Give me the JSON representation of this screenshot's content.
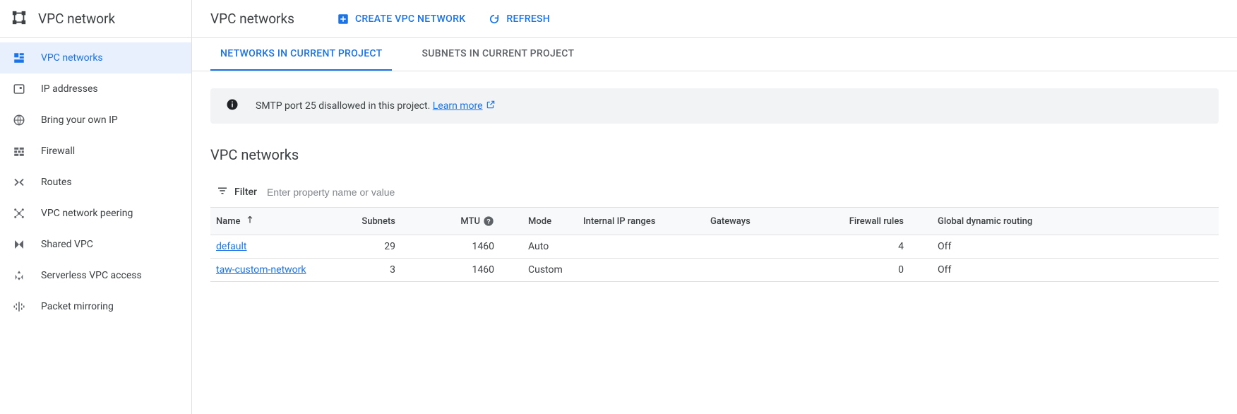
{
  "sidebar": {
    "title": "VPC network",
    "items": [
      {
        "label": "VPC networks"
      },
      {
        "label": "IP addresses"
      },
      {
        "label": "Bring your own IP"
      },
      {
        "label": "Firewall"
      },
      {
        "label": "Routes"
      },
      {
        "label": "VPC network peering"
      },
      {
        "label": "Shared VPC"
      },
      {
        "label": "Serverless VPC access"
      },
      {
        "label": "Packet mirroring"
      }
    ]
  },
  "header": {
    "title": "VPC networks",
    "create_label": "CREATE VPC NETWORK",
    "refresh_label": "REFRESH"
  },
  "tabs": [
    {
      "label": "NETWORKS IN CURRENT PROJECT"
    },
    {
      "label": "SUBNETS IN CURRENT PROJECT"
    }
  ],
  "banner": {
    "message": "SMTP port 25 disallowed in this project. ",
    "learn_more": "Learn more"
  },
  "section_title": "VPC networks",
  "filter": {
    "label": "Filter",
    "placeholder": "Enter property name or value"
  },
  "table": {
    "columns": {
      "name": "Name",
      "subnets": "Subnets",
      "mtu": "MTU",
      "mode": "Mode",
      "internal_ip": "Internal IP ranges",
      "gateways": "Gateways",
      "firewall": "Firewall rules",
      "routing": "Global dynamic routing"
    },
    "rows": [
      {
        "name": "default",
        "subnets": "29",
        "mtu": "1460",
        "mode": "Auto",
        "internal_ip": "",
        "gateways": "",
        "firewall": "4",
        "routing": "Off"
      },
      {
        "name": "taw-custom-network",
        "subnets": "3",
        "mtu": "1460",
        "mode": "Custom",
        "internal_ip": "",
        "gateways": "",
        "firewall": "0",
        "routing": "Off"
      }
    ]
  }
}
